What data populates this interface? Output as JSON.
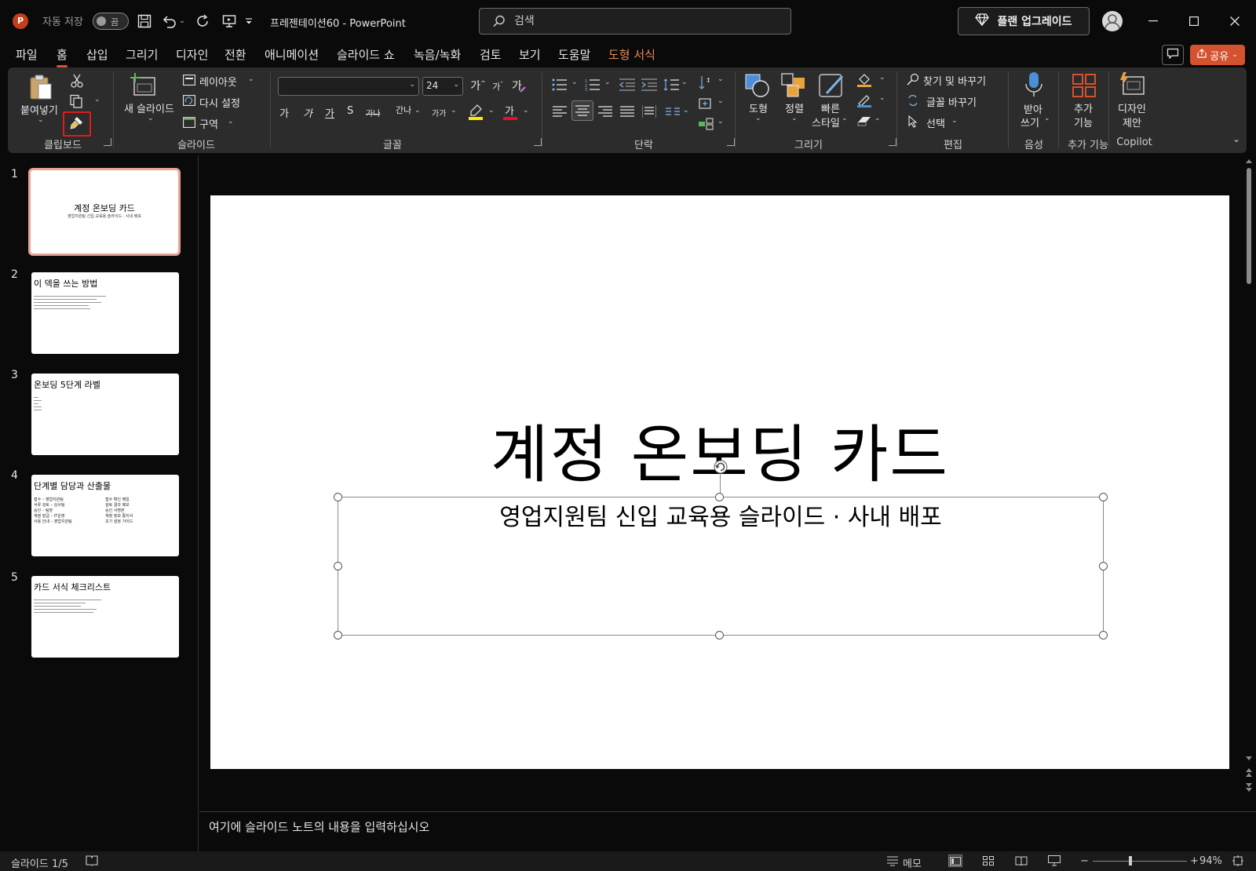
{
  "titlebar": {
    "app_logo": "P",
    "autosave_label": "자동 저장",
    "autosave_state": "끔",
    "doc_title": "프레젠테이션60  -  PowerPoint",
    "search_placeholder": "검색",
    "upgrade_label": "플랜 업그레이드"
  },
  "tabs": [
    "파일",
    "홈",
    "삽입",
    "그리기",
    "디자인",
    "전환",
    "애니메이션",
    "슬라이드 쇼",
    "녹음/녹화",
    "검토",
    "보기",
    "도움말",
    "도형 서식"
  ],
  "active_tab": "홈",
  "share_label": "공유",
  "ribbon": {
    "clipboard": {
      "paste": "붙여넣기",
      "group": "클립보드"
    },
    "slides": {
      "new_slide_l1": "새 슬라이드",
      "layout": "레이아웃",
      "reset": "다시 설정",
      "section": "구역",
      "group": "슬라이드"
    },
    "font": {
      "font_name": "",
      "font_size": "24",
      "group": "글꼴",
      "bold": "가",
      "italic": "가",
      "underline": "가",
      "shadow": "S",
      "strike": "가나",
      "spacing": "간나",
      "case": "가가"
    },
    "paragraph": {
      "group": "단락"
    },
    "drawing": {
      "shape": "도형",
      "arrange": "정렬",
      "quick_style_l1": "빠른",
      "quick_style_l2": "스타일",
      "group": "그리기"
    },
    "editing": {
      "find_replace": "찾기 및 바꾸기",
      "replace_font": "글꼴 바꾸기",
      "select": "선택",
      "group": "편집"
    },
    "voice": {
      "dictate_l1": "받아",
      "dictate_l2": "쓰기",
      "group": "음성"
    },
    "addins": {
      "l1": "추가",
      "l2": "기능",
      "group": "추가 기능"
    },
    "copilot": {
      "l1": "디자인",
      "l2": "제안",
      "group": "Copilot"
    }
  },
  "thumbnails": [
    {
      "num": "1",
      "title": "계정 온보딩 카드",
      "subtitle": "영업지원팀 신입 교육용 슬라이드 · 사내 배포"
    },
    {
      "num": "2",
      "title": "이 덱을 쓰는 방법"
    },
    {
      "num": "3",
      "title": "온보딩 5단계 라벨"
    },
    {
      "num": "4",
      "title": "단계별 담당과 산출물",
      "left": [
        "접수 – 영업지원팀",
        "서류 검토 – 심사팀",
        "승인 – 팀장",
        "계정 발급 – IT운영",
        "사용 안내 – 영업지원팀"
      ],
      "right": [
        "접수 확인 메일",
        "검토 결과 메모",
        "승인 서명본",
        "계정 정보 통지서",
        "초기 설정 가이드"
      ]
    },
    {
      "num": "5",
      "title": "카드 서식 체크리스트"
    }
  ],
  "slide": {
    "title": "계정 온보딩 카드",
    "subtitle": "영업지원팀 신입 교육용 슬라이드 · 사내 배포"
  },
  "notes_placeholder": "여기에 슬라이드 노트의 내용을 입력하십시오",
  "statusbar": {
    "slide_counter": "슬라이드 1/5",
    "notes_label": "메모",
    "zoom_level": "94%",
    "zoom_fraction": 0.94
  },
  "colors": {
    "accent": "#d35230",
    "highlight_box": "#e01b1b",
    "active_thumb_border": "#e8a396"
  }
}
